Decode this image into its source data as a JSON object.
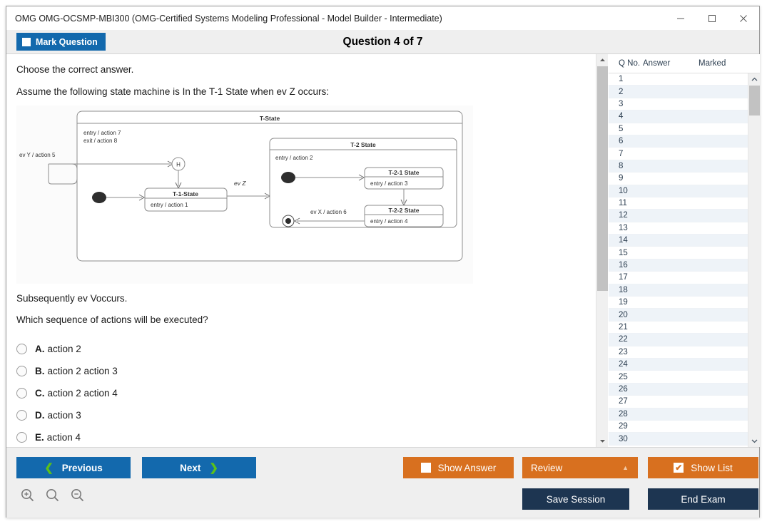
{
  "window": {
    "title": "OMG OMG-OCSMP-MBI300 (OMG-Certified Systems Modeling Professional - Model Builder - Intermediate)",
    "minimize": "—",
    "maximize": "□",
    "close": "✕"
  },
  "header": {
    "mark_label": "Mark Question",
    "question_title": "Question 4 of 7"
  },
  "question": {
    "intro": "Choose the correct answer.",
    "stem": "Assume the following state machine is In the T-1 State when ev Z occurs:",
    "sub": "Subsequently ev Voccurs.",
    "ask": "Which sequence of actions will be executed?",
    "options": [
      {
        "letter": "A.",
        "text": "action 2"
      },
      {
        "letter": "B.",
        "text": "action 2 action 3"
      },
      {
        "letter": "C.",
        "text": "action 2 action 4"
      },
      {
        "letter": "D.",
        "text": "action 3"
      },
      {
        "letter": "E.",
        "text": "action 4"
      }
    ]
  },
  "diagram": {
    "outer_state": "T-State",
    "outer_entry": "entry / action 7",
    "outer_exit": "exit / action 8",
    "ev_y_label": "ev Y / action 5",
    "history_label": "H",
    "t1_name": "T-1-State",
    "t1_entry": "entry / action 1",
    "ev_z_label": "ev Z",
    "t2_name": "T-2 State",
    "t2_entry": "entry / action 2",
    "t21_name": "T-2-1 State",
    "t21_entry": "entry / action 3",
    "t22_name": "T-2-2 State",
    "t22_entry": "entry / action 4",
    "ev_x_label": "ev X / action 6"
  },
  "list": {
    "columns": [
      "Q No.",
      "Answer",
      "Marked"
    ],
    "rows": [
      {
        "q": "1",
        "answer": "",
        "marked": ""
      },
      {
        "q": "2",
        "answer": "",
        "marked": ""
      },
      {
        "q": "3",
        "answer": "",
        "marked": ""
      },
      {
        "q": "4",
        "answer": "",
        "marked": ""
      },
      {
        "q": "5",
        "answer": "",
        "marked": ""
      },
      {
        "q": "6",
        "answer": "",
        "marked": ""
      },
      {
        "q": "7",
        "answer": "",
        "marked": ""
      },
      {
        "q": "8",
        "answer": "",
        "marked": ""
      },
      {
        "q": "9",
        "answer": "",
        "marked": ""
      },
      {
        "q": "10",
        "answer": "",
        "marked": ""
      },
      {
        "q": "11",
        "answer": "",
        "marked": ""
      },
      {
        "q": "12",
        "answer": "",
        "marked": ""
      },
      {
        "q": "13",
        "answer": "",
        "marked": ""
      },
      {
        "q": "14",
        "answer": "",
        "marked": ""
      },
      {
        "q": "15",
        "answer": "",
        "marked": ""
      },
      {
        "q": "16",
        "answer": "",
        "marked": ""
      },
      {
        "q": "17",
        "answer": "",
        "marked": ""
      },
      {
        "q": "18",
        "answer": "",
        "marked": ""
      },
      {
        "q": "19",
        "answer": "",
        "marked": ""
      },
      {
        "q": "20",
        "answer": "",
        "marked": ""
      },
      {
        "q": "21",
        "answer": "",
        "marked": ""
      },
      {
        "q": "22",
        "answer": "",
        "marked": ""
      },
      {
        "q": "23",
        "answer": "",
        "marked": ""
      },
      {
        "q": "24",
        "answer": "",
        "marked": ""
      },
      {
        "q": "25",
        "answer": "",
        "marked": ""
      },
      {
        "q": "26",
        "answer": "",
        "marked": ""
      },
      {
        "q": "27",
        "answer": "",
        "marked": ""
      },
      {
        "q": "28",
        "answer": "",
        "marked": ""
      },
      {
        "q": "29",
        "answer": "",
        "marked": ""
      },
      {
        "q": "30",
        "answer": "",
        "marked": ""
      }
    ]
  },
  "toolbar": {
    "previous_label": "Previous",
    "next_label": "Next",
    "prev_chevron": "❮",
    "next_chevron": "❯",
    "show_answer_label": "Show Answer",
    "show_answer_checked": false,
    "review_label": "Review",
    "review_caret": "▲",
    "show_list_label": "Show List",
    "show_list_checked": true,
    "show_list_check_glyph": "✔",
    "save_session_label": "Save Session",
    "end_exam_label": "End Exam"
  },
  "colors": {
    "primary_blue": "#1369ad",
    "accent_orange": "#d8701f",
    "navy": "#1d3551",
    "chevron_green": "#5cc11a",
    "row_alt": "#eef3f8"
  }
}
